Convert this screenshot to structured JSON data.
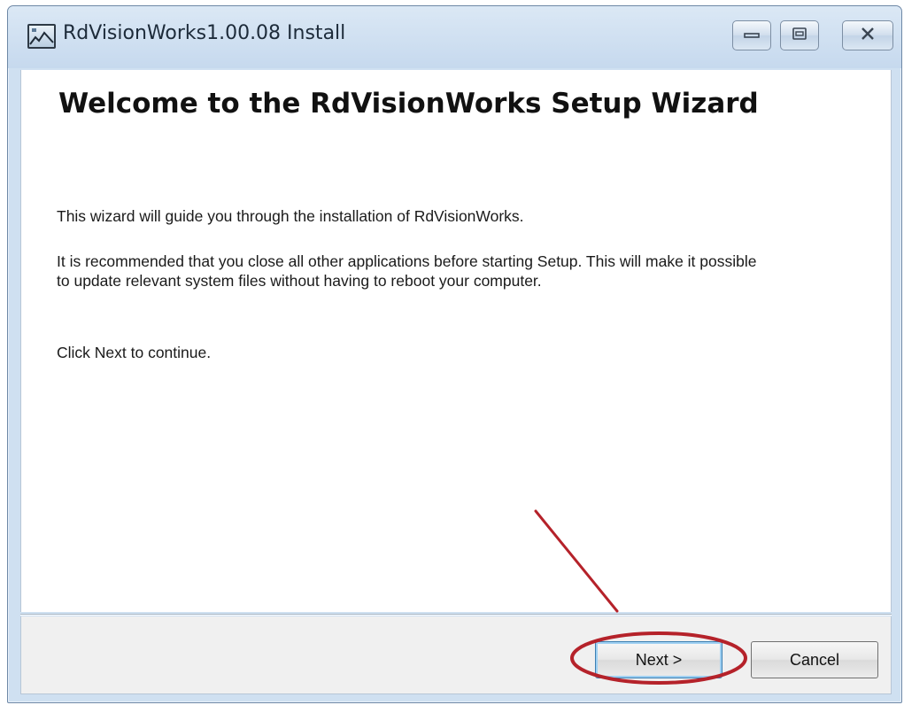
{
  "window": {
    "title": "RdVisionWorks1.00.08 Install",
    "icon": "installer-app-icon",
    "controls": [
      "minimize-icon",
      "maximize-icon",
      "close-icon"
    ]
  },
  "main": {
    "heading": "Welcome to the RdVisionWorks Setup Wizard",
    "paragraphs": [
      "This wizard will guide you through the installation of RdVisionWorks.",
      "It is recommended that you close all other applications before starting Setup. This will make it possible to update relevant system files without having to reboot your computer.",
      "Click Next to continue."
    ]
  },
  "footer": {
    "next_label": "Next >",
    "cancel_label": "Cancel"
  },
  "colors": {
    "frame": "#cfe0f1",
    "annotation": "#b5222a",
    "focus": "#3c7fb1"
  }
}
